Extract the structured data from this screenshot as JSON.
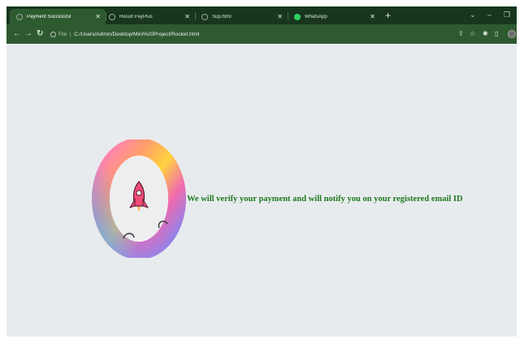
{
  "tabs": [
    {
      "title": "Payment Successful",
      "active": true,
      "favicon": "globe-icon"
    },
    {
      "title": "Result PayPlus",
      "active": false,
      "favicon": "globe-icon"
    },
    {
      "title": "Sup.html",
      "active": false,
      "favicon": "globe-icon"
    },
    {
      "title": "WhatsApp",
      "active": false,
      "favicon": "whatsapp-icon"
    }
  ],
  "toolbar": {
    "url_scheme": "File",
    "url_path": "C:/Users/Admin/Desktop/Mini%20Project/Rocket.html"
  },
  "page": {
    "message": "We will verify your payment and will notify you on your registered email ID"
  },
  "colors": {
    "tabstrip_bg": "#17361d",
    "toolbar_bg": "#2e5a30",
    "page_bg": "#e8ebee",
    "message_text": "#1f7a1f",
    "rocket": "#ee4c78"
  }
}
